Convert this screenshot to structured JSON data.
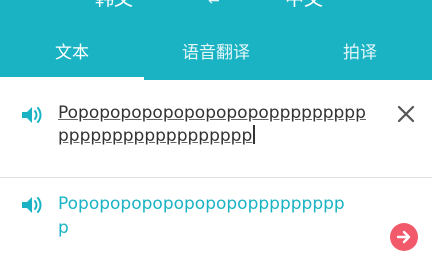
{
  "header": {
    "source_language": "韩文",
    "target_language": "中文",
    "swap_icon": "swap-arrows-icon"
  },
  "tabs": [
    {
      "label": "文本",
      "active": true
    },
    {
      "label": "语音翻译",
      "active": false
    },
    {
      "label": "拍译",
      "active": false
    }
  ],
  "input": {
    "line1": "Popopopopopopopopopoppppppppp",
    "line2": "pppppppppppppppppp",
    "speaker_icon": "speaker-icon",
    "clear_icon": "close-icon"
  },
  "result": {
    "line1": "Popopopopopopopopoppppppppp",
    "line2": "p",
    "speaker_icon": "speaker-icon",
    "action_icon": "arrow-right-icon"
  },
  "colors": {
    "accent": "#1ab3c4",
    "action": "#f25a6b"
  }
}
